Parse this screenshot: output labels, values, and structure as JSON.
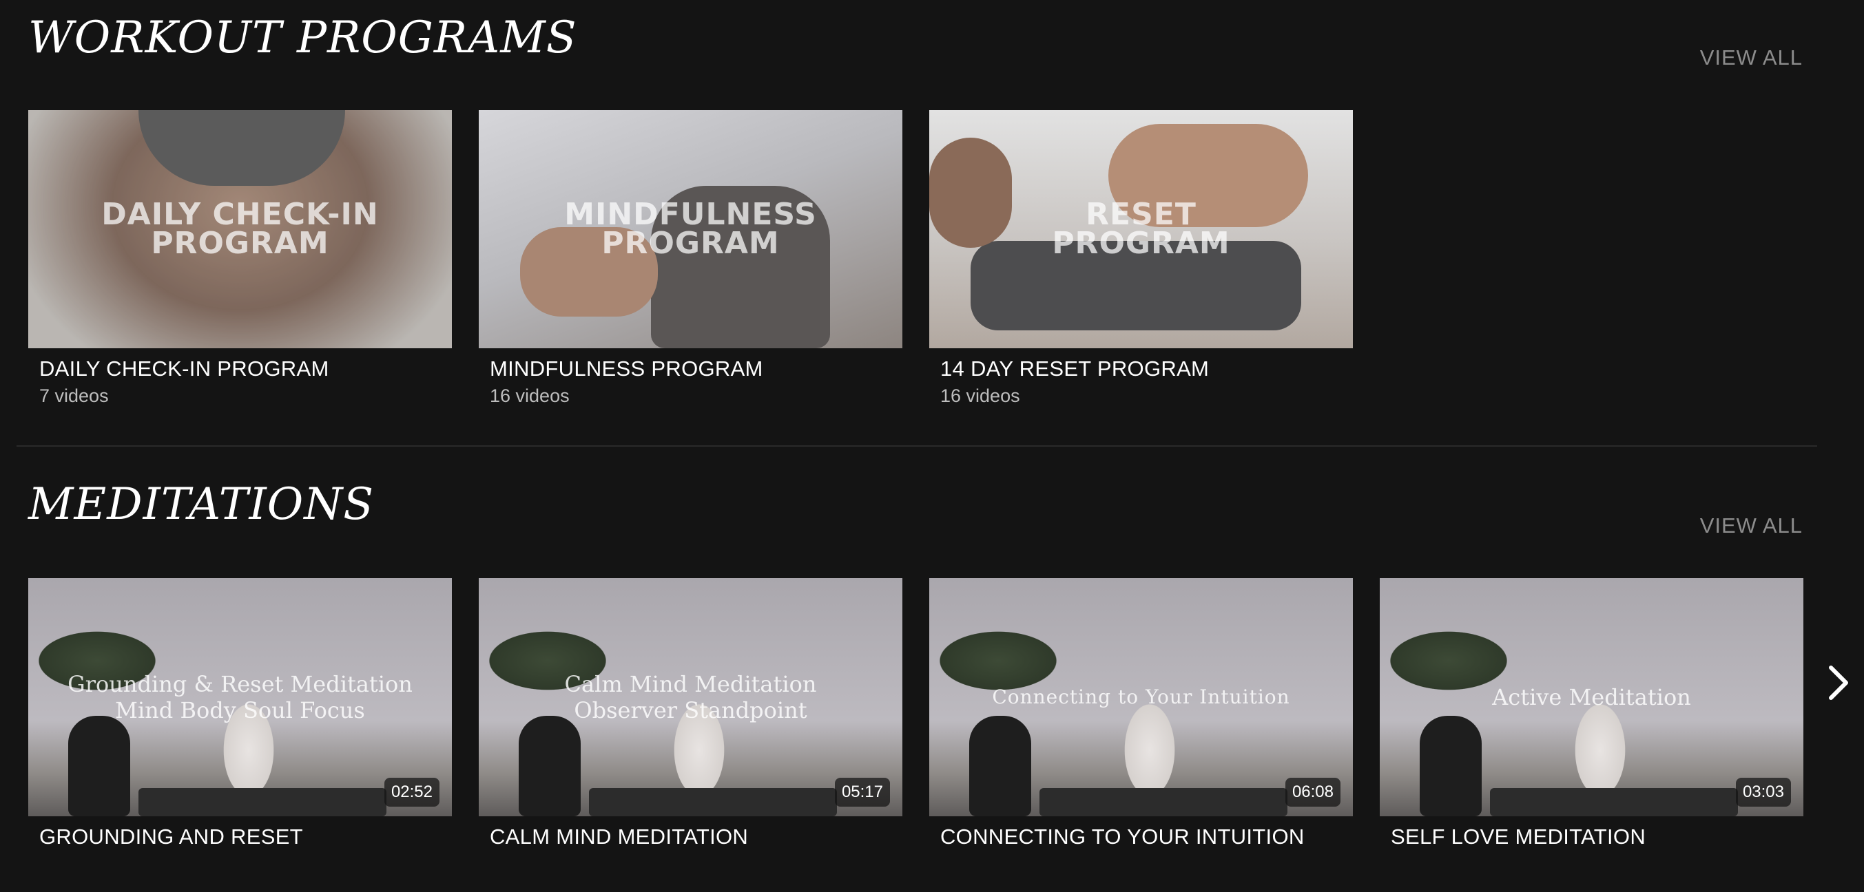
{
  "workout_programs": {
    "title": "WORKOUT PROGRAMS",
    "view_all_label": "VIEW ALL",
    "cards": [
      {
        "overlay": "DAILY CHECK-IN\nPROGRAM",
        "title": "DAILY CHECK-IN PROGRAM",
        "subtitle": "7 videos"
      },
      {
        "overlay": "MINDFULNESS\nPROGRAM",
        "title": "MINDFULNESS PROGRAM",
        "subtitle": "16 videos"
      },
      {
        "overlay": "RESET\nPROGRAM",
        "title": "14 DAY RESET PROGRAM",
        "subtitle": "16 videos"
      }
    ]
  },
  "meditations": {
    "title": "MEDITATIONS",
    "view_all_label": "VIEW ALL",
    "cards": [
      {
        "overlay": "Grounding & Reset Meditation\nMind Body Soul Focus",
        "title": "GROUNDING AND RESET",
        "duration": "02:52"
      },
      {
        "overlay": "Calm Mind Meditation\nObserver Standpoint",
        "title": "CALM MIND MEDITATION",
        "duration": "05:17"
      },
      {
        "overlay": "Connecting to Your Intuition",
        "title": "CONNECTING TO YOUR INTUITION",
        "duration": "06:08"
      },
      {
        "overlay": "Active Meditation",
        "title": "SELF LOVE MEDITATION",
        "duration": "03:03"
      }
    ]
  },
  "carousel": {
    "next_icon": "chevron-right-icon"
  },
  "colors": {
    "background": "#141414",
    "text": "#ffffff",
    "muted": "#8c8c8c",
    "subtitle": "#bdbdbd"
  }
}
